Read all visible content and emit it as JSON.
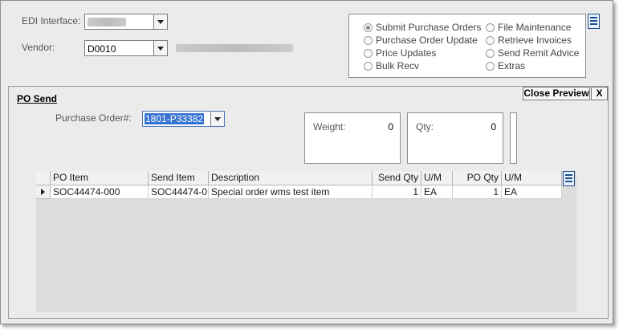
{
  "top": {
    "edi_label": "EDI Interface:",
    "edi_value": "",
    "vendor_label": "Vendor:",
    "vendor_value": "D0010"
  },
  "options": [
    {
      "label": "Submit Purchase Orders",
      "selected": true
    },
    {
      "label": "Purchase Order Update",
      "selected": false
    },
    {
      "label": "Price Updates",
      "selected": false
    },
    {
      "label": "Bulk Recv",
      "selected": false
    },
    {
      "label": "File Maintenance",
      "selected": false
    },
    {
      "label": "Retrieve Invoices",
      "selected": false
    },
    {
      "label": "Send Remit Advice",
      "selected": false
    },
    {
      "label": "Extras",
      "selected": false
    }
  ],
  "panel": {
    "title": "PO Send",
    "close_preview": "Close Preview",
    "close_x": "X",
    "po_label": "Purchase Order#:",
    "po_value": "1801-P33382",
    "weight_label": "Weight:",
    "weight_value": "0",
    "qty_label": "Qty:",
    "qty_value": "0"
  },
  "grid": {
    "columns": [
      "PO Item",
      "Send Item",
      "Description",
      "Send Qty",
      "U/M",
      "PO Qty",
      "U/M"
    ],
    "rows": [
      [
        "SOC44474-000",
        "SOC44474-0",
        "Special order wms test item",
        "1",
        "EA",
        "1",
        "EA"
      ]
    ]
  },
  "icons": {
    "options_menu": "hamburger-menu-icon",
    "grid_menu": "hamburger-menu-icon",
    "dropdown": "chevron-down-icon",
    "row_pointer": "row-pointer-icon"
  },
  "colors": {
    "selection": "#3874d3",
    "menu_icon": "#1c4f8e"
  }
}
